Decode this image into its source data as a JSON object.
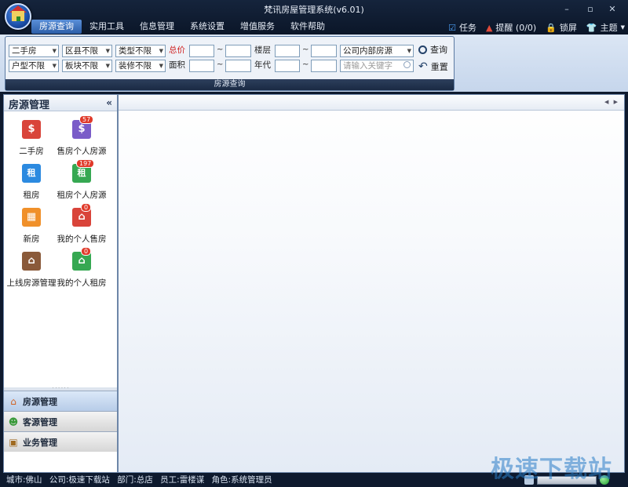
{
  "app": {
    "title": "梵讯房屋管理系统(v6.01)",
    "window_controls": {
      "minimize": "–",
      "maximize": "▫",
      "close": "✕"
    }
  },
  "menu": {
    "items": [
      {
        "label": "房源查询",
        "active": true
      },
      {
        "label": "实用工具"
      },
      {
        "label": "信息管理"
      },
      {
        "label": "系统设置"
      },
      {
        "label": "增值服务"
      },
      {
        "label": "软件帮助"
      }
    ],
    "right": [
      {
        "label": "任务",
        "icon": "task-icon"
      },
      {
        "label": "提醒 (0/0)",
        "icon": "bell-icon"
      },
      {
        "label": "锁屏",
        "icon": "lock-icon"
      },
      {
        "label": "主题",
        "icon": "shirt-icon"
      }
    ]
  },
  "search": {
    "footer": "房源查询",
    "selects": {
      "house_type": "二手房",
      "district": "区县不限",
      "category": "类型不限",
      "layout": "户型不限",
      "block": "板块不限",
      "decoration": "装修不限",
      "source": "公司内部房源"
    },
    "labels": {
      "price": "总价",
      "area": "面积",
      "floor": "楼层",
      "year": "年代",
      "tilde": "~"
    },
    "keyword_placeholder": "请输入关键字",
    "query_button": "查询",
    "reset_button": "重置"
  },
  "left_panel": {
    "title": "房源管理",
    "collapse": "«",
    "tiles": [
      {
        "label": "二手房",
        "color": "#d9443a",
        "glyph": "$"
      },
      {
        "label": "售房个人房源",
        "color": "#7a5cc8",
        "glyph": "$",
        "badge": "57"
      },
      {
        "label": "租房",
        "color": "#2c8ae0",
        "glyph": "租"
      },
      {
        "label": "租房个人房源",
        "color": "#36a852",
        "glyph": "租",
        "badge": "197"
      },
      {
        "label": "新房",
        "color": "#f0902a",
        "glyph": "▦"
      },
      {
        "label": "我的个人售房",
        "color": "#d9443a",
        "glyph": "⌂",
        "badge": "0"
      },
      {
        "label": "上线房源管理",
        "color": "#8a5a3a",
        "glyph": "⌂"
      },
      {
        "label": "我的个人租房",
        "color": "#36a852",
        "glyph": "⌂",
        "badge": "0"
      }
    ],
    "nav_tabs": [
      {
        "label": "房源管理",
        "icon": "house-icon",
        "active": true
      },
      {
        "label": "客源管理",
        "icon": "customers-icon"
      },
      {
        "label": "业务管理",
        "icon": "briefcase-icon"
      }
    ]
  },
  "main": {
    "scroll_arrows": "◀ ▶"
  },
  "status": {
    "city": "城市:佛山",
    "company": "公司:极速下载站",
    "department": "部门:总店",
    "employee": "员工:雷楼谋",
    "role": "角色:系统管理员"
  },
  "watermark": "极速下载站"
}
